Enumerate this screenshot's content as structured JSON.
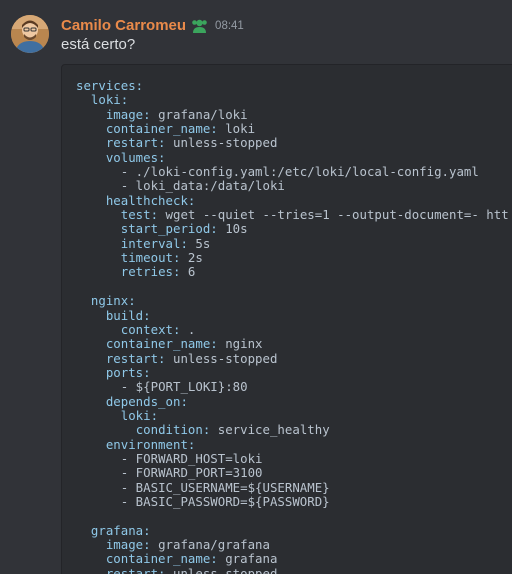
{
  "message": {
    "author": "Camilo Carromeu",
    "role_icon": "green-role-badge-icon",
    "timestamp": "08:41",
    "text": "está certo?",
    "avatar_icon": "user-avatar"
  },
  "code_block": {
    "lines": [
      {
        "indent": "",
        "key": "services:",
        "value": ""
      },
      {
        "indent": "  ",
        "key": "loki:",
        "value": ""
      },
      {
        "indent": "    ",
        "key": "image:",
        "value": " grafana/loki"
      },
      {
        "indent": "    ",
        "key": "container_name:",
        "value": " loki"
      },
      {
        "indent": "    ",
        "key": "restart:",
        "value": " unless-stopped"
      },
      {
        "indent": "    ",
        "key": "volumes:",
        "value": ""
      },
      {
        "indent": "      ",
        "key": "",
        "value": "- ./loki-config.yaml:/etc/loki/local-config.yaml"
      },
      {
        "indent": "      ",
        "key": "",
        "value": "- loki_data:/data/loki"
      },
      {
        "indent": "    ",
        "key": "healthcheck:",
        "value": ""
      },
      {
        "indent": "      ",
        "key": "test:",
        "value": " wget --quiet --tries=1 --output-document=- htt"
      },
      {
        "indent": "      ",
        "key": "start_period:",
        "value": " 10s"
      },
      {
        "indent": "      ",
        "key": "interval:",
        "value": " 5s"
      },
      {
        "indent": "      ",
        "key": "timeout:",
        "value": " 2s"
      },
      {
        "indent": "      ",
        "key": "retries:",
        "value": " 6"
      },
      {
        "indent": "",
        "key": "",
        "value": ""
      },
      {
        "indent": "  ",
        "key": "nginx:",
        "value": ""
      },
      {
        "indent": "    ",
        "key": "build:",
        "value": ""
      },
      {
        "indent": "      ",
        "key": "context:",
        "value": " ."
      },
      {
        "indent": "    ",
        "key": "container_name:",
        "value": " nginx"
      },
      {
        "indent": "    ",
        "key": "restart:",
        "value": " unless-stopped"
      },
      {
        "indent": "    ",
        "key": "ports:",
        "value": ""
      },
      {
        "indent": "      ",
        "key": "",
        "value": "- ${PORT_LOKI}:80"
      },
      {
        "indent": "    ",
        "key": "depends_on:",
        "value": ""
      },
      {
        "indent": "      ",
        "key": "loki:",
        "value": ""
      },
      {
        "indent": "        ",
        "key": "condition:",
        "value": " service_healthy"
      },
      {
        "indent": "    ",
        "key": "environment:",
        "value": ""
      },
      {
        "indent": "      ",
        "key": "",
        "value": "- FORWARD_HOST=loki"
      },
      {
        "indent": "      ",
        "key": "",
        "value": "- FORWARD_PORT=3100"
      },
      {
        "indent": "      ",
        "key": "",
        "value": "- BASIC_USERNAME=${USERNAME}"
      },
      {
        "indent": "      ",
        "key": "",
        "value": "- BASIC_PASSWORD=${PASSWORD}"
      },
      {
        "indent": "",
        "key": "",
        "value": ""
      },
      {
        "indent": "  ",
        "key": "grafana:",
        "value": ""
      },
      {
        "indent": "    ",
        "key": "image:",
        "value": " grafana/grafana"
      },
      {
        "indent": "    ",
        "key": "container_name:",
        "value": " grafana"
      },
      {
        "indent": "    ",
        "key": "restart:",
        "value": " unless-stopped"
      }
    ]
  },
  "colors": {
    "background": "#313338",
    "code_background": "#2b2d31",
    "username": "#e98a4a",
    "yaml_key": "#8fc8e8",
    "yaml_value": "#b9c3ce",
    "timestamp": "#949ba4",
    "role_badge": "#3ba55d"
  }
}
